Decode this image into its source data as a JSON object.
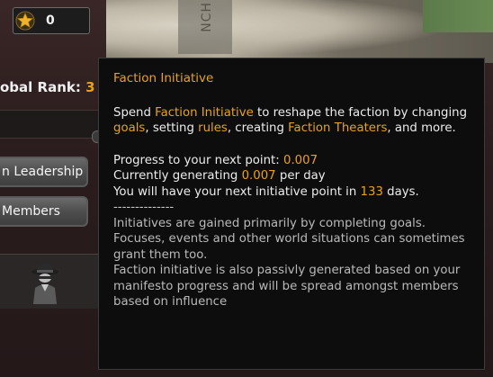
{
  "hud": {
    "score_value": "0",
    "global_rank_label": "obal Rank:",
    "global_rank_value": "3"
  },
  "map": {
    "vertical_text": "NCH"
  },
  "side_buttons": {
    "leadership_label": "n Leadership",
    "members_label": "Members"
  },
  "tooltip": {
    "title": "Faction Initiative",
    "desc": {
      "p1": "Spend ",
      "h1": "Faction Initiative",
      "p2": " to reshape the faction by changing ",
      "h2": "goals",
      "p3": ", setting ",
      "h3": "rules",
      "p4": ", creating ",
      "h4": "Faction Theaters",
      "p5": ", and more."
    },
    "progress": {
      "label": "Progress to your next point: ",
      "value": "0.007"
    },
    "generating": {
      "label": "Currently generating ",
      "value": "0.007",
      "suffix": " per day"
    },
    "next_point": {
      "label": "You will have your next initiative point in ",
      "value": "133",
      "suffix": " days."
    },
    "separator": "--------------",
    "info1": "Initiatives are gained primarily by completing goals. Focuses, events and other world situations can sometimes grant them too.",
    "info2": "Faction initiative is also passivly generated based on your manifesto progress and will be spread amongst members based on influence"
  },
  "colors": {
    "highlight": "#e8a21c",
    "tooltip_bg": "#0d0d0d",
    "text": "#ececec"
  }
}
